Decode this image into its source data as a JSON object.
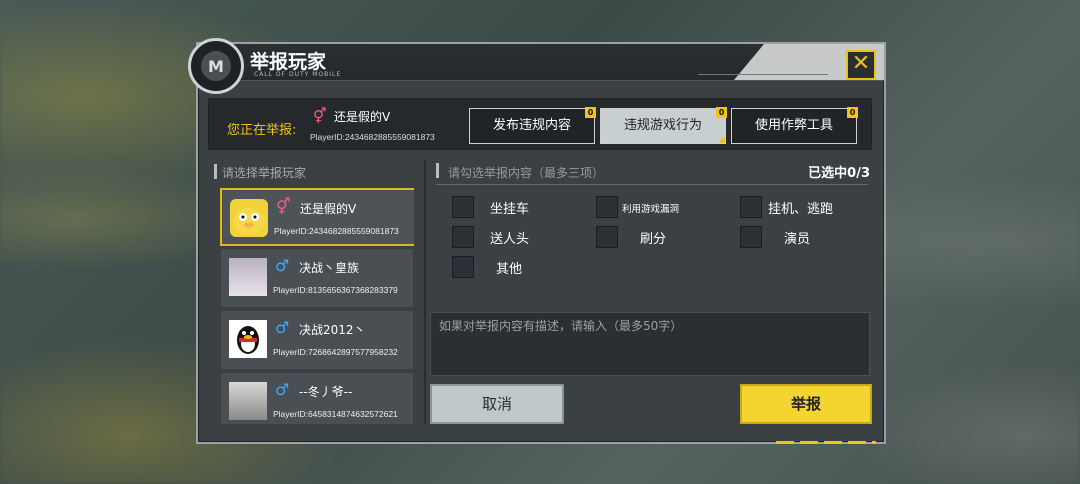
{
  "dialog": {
    "title": "举报玩家",
    "subtitle": "CALL OF DUTY MOBILE",
    "close_label": "✕"
  },
  "report_target": {
    "label": "您正在举报:",
    "name": "还是假的V",
    "player_id": "PlayerID:2434682885559081873"
  },
  "categories": [
    {
      "label": "发布违规内容",
      "badge": "0",
      "active": false
    },
    {
      "label": "违规游戏行为",
      "badge": "0",
      "active": true
    },
    {
      "label": "使用作弊工具",
      "badge": "0",
      "active": false
    }
  ],
  "player_panel": {
    "header": "请选择举报玩家",
    "players": [
      {
        "name": "还是假的V",
        "id": "PlayerID:2434682885559081873",
        "gender": "female"
      },
      {
        "name": "决战丶皇族",
        "id": "PlayerID:8135656367368283379",
        "gender": "male"
      },
      {
        "name": "决战2012丶",
        "id": "PlayerID:7268642897577958232",
        "gender": "male"
      },
      {
        "name": "--冬丿爷--",
        "id": "PlayerID:6458314874632572621",
        "gender": "male"
      }
    ]
  },
  "options_panel": {
    "header": "请勾选举报内容（最多三项）",
    "selected_count": "已选中0/3",
    "options": [
      "坐挂车",
      "利用游戏漏洞",
      "挂机、逃跑",
      "送人头",
      "刷分",
      "演员",
      "其他"
    ]
  },
  "description": {
    "placeholder": "如果对举报内容有描述，请输入（最多50字）"
  },
  "actions": {
    "cancel_label": "取消",
    "report_label": "举报"
  },
  "colors": {
    "accent": "#f0c419",
    "female": "#ff5a86",
    "male": "#3fa9ff"
  }
}
